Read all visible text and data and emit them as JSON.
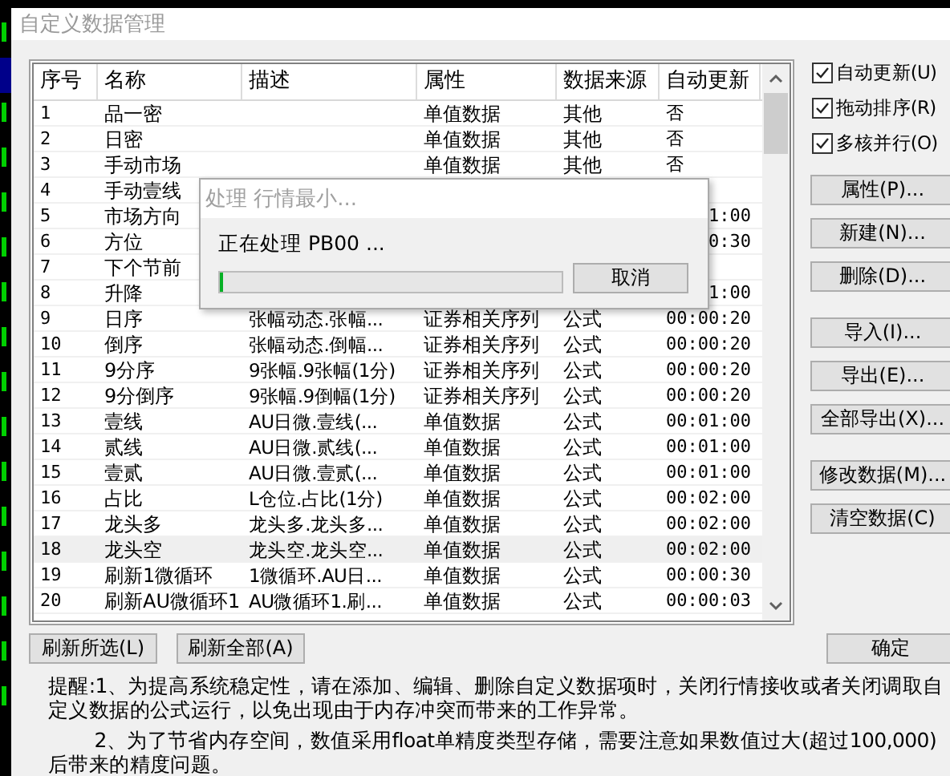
{
  "window": {
    "title": "自定义数据管理"
  },
  "table": {
    "columns": [
      "序号",
      "名称",
      "描述",
      "属性",
      "数据来源",
      "自动更新"
    ],
    "rows": [
      {
        "no": "1",
        "name": "品一密",
        "attr": "单值数据",
        "source": "其他",
        "auto": "否",
        "selected": false
      },
      {
        "no": "2",
        "name": "日密",
        "attr": "单值数据",
        "source": "其他",
        "auto": "否",
        "selected": false
      },
      {
        "no": "3",
        "name": "手动市场",
        "attr": "单值数据",
        "source": "其他",
        "auto": "否",
        "selected": false
      },
      {
        "no": "4",
        "name": "手动壹线",
        "selected": false
      },
      {
        "no": "5",
        "name": "市场方向",
        "auto": "1:00",
        "selected": false
      },
      {
        "no": "6",
        "name": "方位",
        "auto": "0:30",
        "selected": false
      },
      {
        "no": "7",
        "name": "下个节前",
        "selected": false
      },
      {
        "no": "8",
        "name": "升降",
        "auto": "1:00",
        "selected": false
      },
      {
        "no": "9",
        "name": "日序",
        "desc": "张幅动态.张幅...",
        "attr": "证券相关序列",
        "source": "公式",
        "auto": "00:00:20",
        "selected": false
      },
      {
        "no": "10",
        "name": "倒序",
        "desc": "张幅动态.倒幅...",
        "attr": "证券相关序列",
        "source": "公式",
        "auto": "00:00:20",
        "selected": false
      },
      {
        "no": "11",
        "name": "9分序",
        "desc": "9张幅.9张幅(1分)",
        "attr": "证券相关序列",
        "source": "公式",
        "auto": "00:00:20",
        "selected": false
      },
      {
        "no": "12",
        "name": "9分倒序",
        "desc": "9张幅.9倒幅(1分)",
        "attr": "证券相关序列",
        "source": "公式",
        "auto": "00:00:20",
        "selected": false
      },
      {
        "no": "13",
        "name": "壹线",
        "desc": "AU日微.壹线(...",
        "attr": "单值数据",
        "source": "公式",
        "auto": "00:01:00",
        "selected": false
      },
      {
        "no": "14",
        "name": "贰线",
        "desc": "AU日微.贰线(...",
        "attr": "单值数据",
        "source": "公式",
        "auto": "00:01:00",
        "selected": false
      },
      {
        "no": "15",
        "name": "壹贰",
        "desc": "AU日微.壹贰(...",
        "attr": "单值数据",
        "source": "公式",
        "auto": "00:01:00",
        "selected": false
      },
      {
        "no": "16",
        "name": "占比",
        "desc": "L仓位.占比(1分)",
        "attr": "单值数据",
        "source": "公式",
        "auto": "00:02:00",
        "selected": false
      },
      {
        "no": "17",
        "name": "龙头多",
        "desc": "龙头多.龙头多...",
        "attr": "单值数据",
        "source": "公式",
        "auto": "00:02:00",
        "selected": false
      },
      {
        "no": "18",
        "name": "龙头空",
        "desc": "龙头空.龙头空...",
        "attr": "单值数据",
        "source": "公式",
        "auto": "00:02:00",
        "selected": true
      },
      {
        "no": "19",
        "name": "刷新1微循环",
        "desc": "1微循环.AU日...",
        "attr": "单值数据",
        "source": "公式",
        "auto": "00:00:30",
        "selected": false
      },
      {
        "no": "20",
        "name": "刷新AU微循环1",
        "desc": "AU微循环1.刷...",
        "attr": "单值数据",
        "source": "公式",
        "auto": "00:00:03",
        "selected": false
      }
    ]
  },
  "dialog": {
    "title": "处理 行情最小...",
    "message": "正在处理 PB00 ...",
    "progress": {
      "level": 0
    },
    "cancel": "取消"
  },
  "options": [
    {
      "label": "自动更新(U)",
      "checked": true
    },
    {
      "label": "拖动排序(R)",
      "checked": true
    },
    {
      "label": "多核并行(O)",
      "checked": true
    }
  ],
  "side_buttons": [
    [
      "属性(P)...",
      "新建(N)...",
      "删除(D)..."
    ],
    [
      "导入(I)...",
      "导出(E)...",
      "全部导出(X)..."
    ],
    [
      "修改数据(M)...",
      "清空数据(C)"
    ]
  ],
  "bottom_buttons": [
    "刷新所选(L)",
    "刷新全部(A)"
  ],
  "ok": "确定",
  "notes": [
    "提醒:1、为提高系统稳定性，请在添加、编辑、删除自定义数据项时，关闭行情接收或者关闭调取自定义数据的公式运行，以免出现由于内存冲突而带来的工作异常。",
    "2、为了节省内存空间，数值采用float单精度类型存储，需要注意如果数值过大(超过100,000)后带来的精度问题。"
  ]
}
